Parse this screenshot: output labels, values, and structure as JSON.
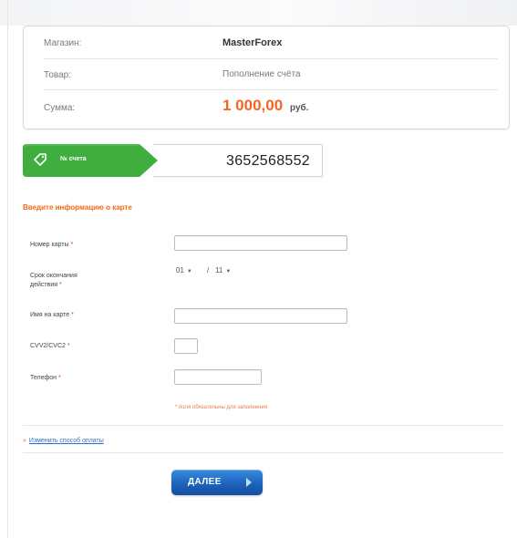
{
  "order": {
    "rows": [
      {
        "label": "Магазин:",
        "value": "MasterForex"
      },
      {
        "label": "Товар:",
        "value": "Пополнение счёта"
      },
      {
        "label": "Сумма:",
        "amount": "1 000,00",
        "currency": "руб."
      }
    ]
  },
  "account": {
    "label": "№ счета",
    "number": "3652568552",
    "tag_icon": "price-tag-icon",
    "tag_color": "#3fae3f"
  },
  "card_form": {
    "title": "Введите информацию о карте",
    "required_mark": "*",
    "fields": {
      "card_number": {
        "label": "Номер карты",
        "value": ""
      },
      "expiry": {
        "label_line1": "Срок окончания",
        "label_line2": "действия",
        "month": "01",
        "separator": "/",
        "year": "11"
      },
      "cardholder": {
        "label": "Имя на карте",
        "value": ""
      },
      "cvv": {
        "label": "CVV2/CVC2",
        "value": ""
      },
      "phone": {
        "label": "Телефон",
        "value": ""
      }
    },
    "required_note": "* поля обязательны для заполнения"
  },
  "change_method": {
    "bullet": "»",
    "label": "Изменить способ оплаты"
  },
  "next_button": {
    "label": "ДАЛЕЕ",
    "icon": "arrow-right-icon"
  },
  "colors": {
    "accent_orange": "#f06a1c",
    "amount_orange": "#f26522",
    "button_blue": "#1d63bd",
    "link_blue": "#2a6ec8"
  }
}
